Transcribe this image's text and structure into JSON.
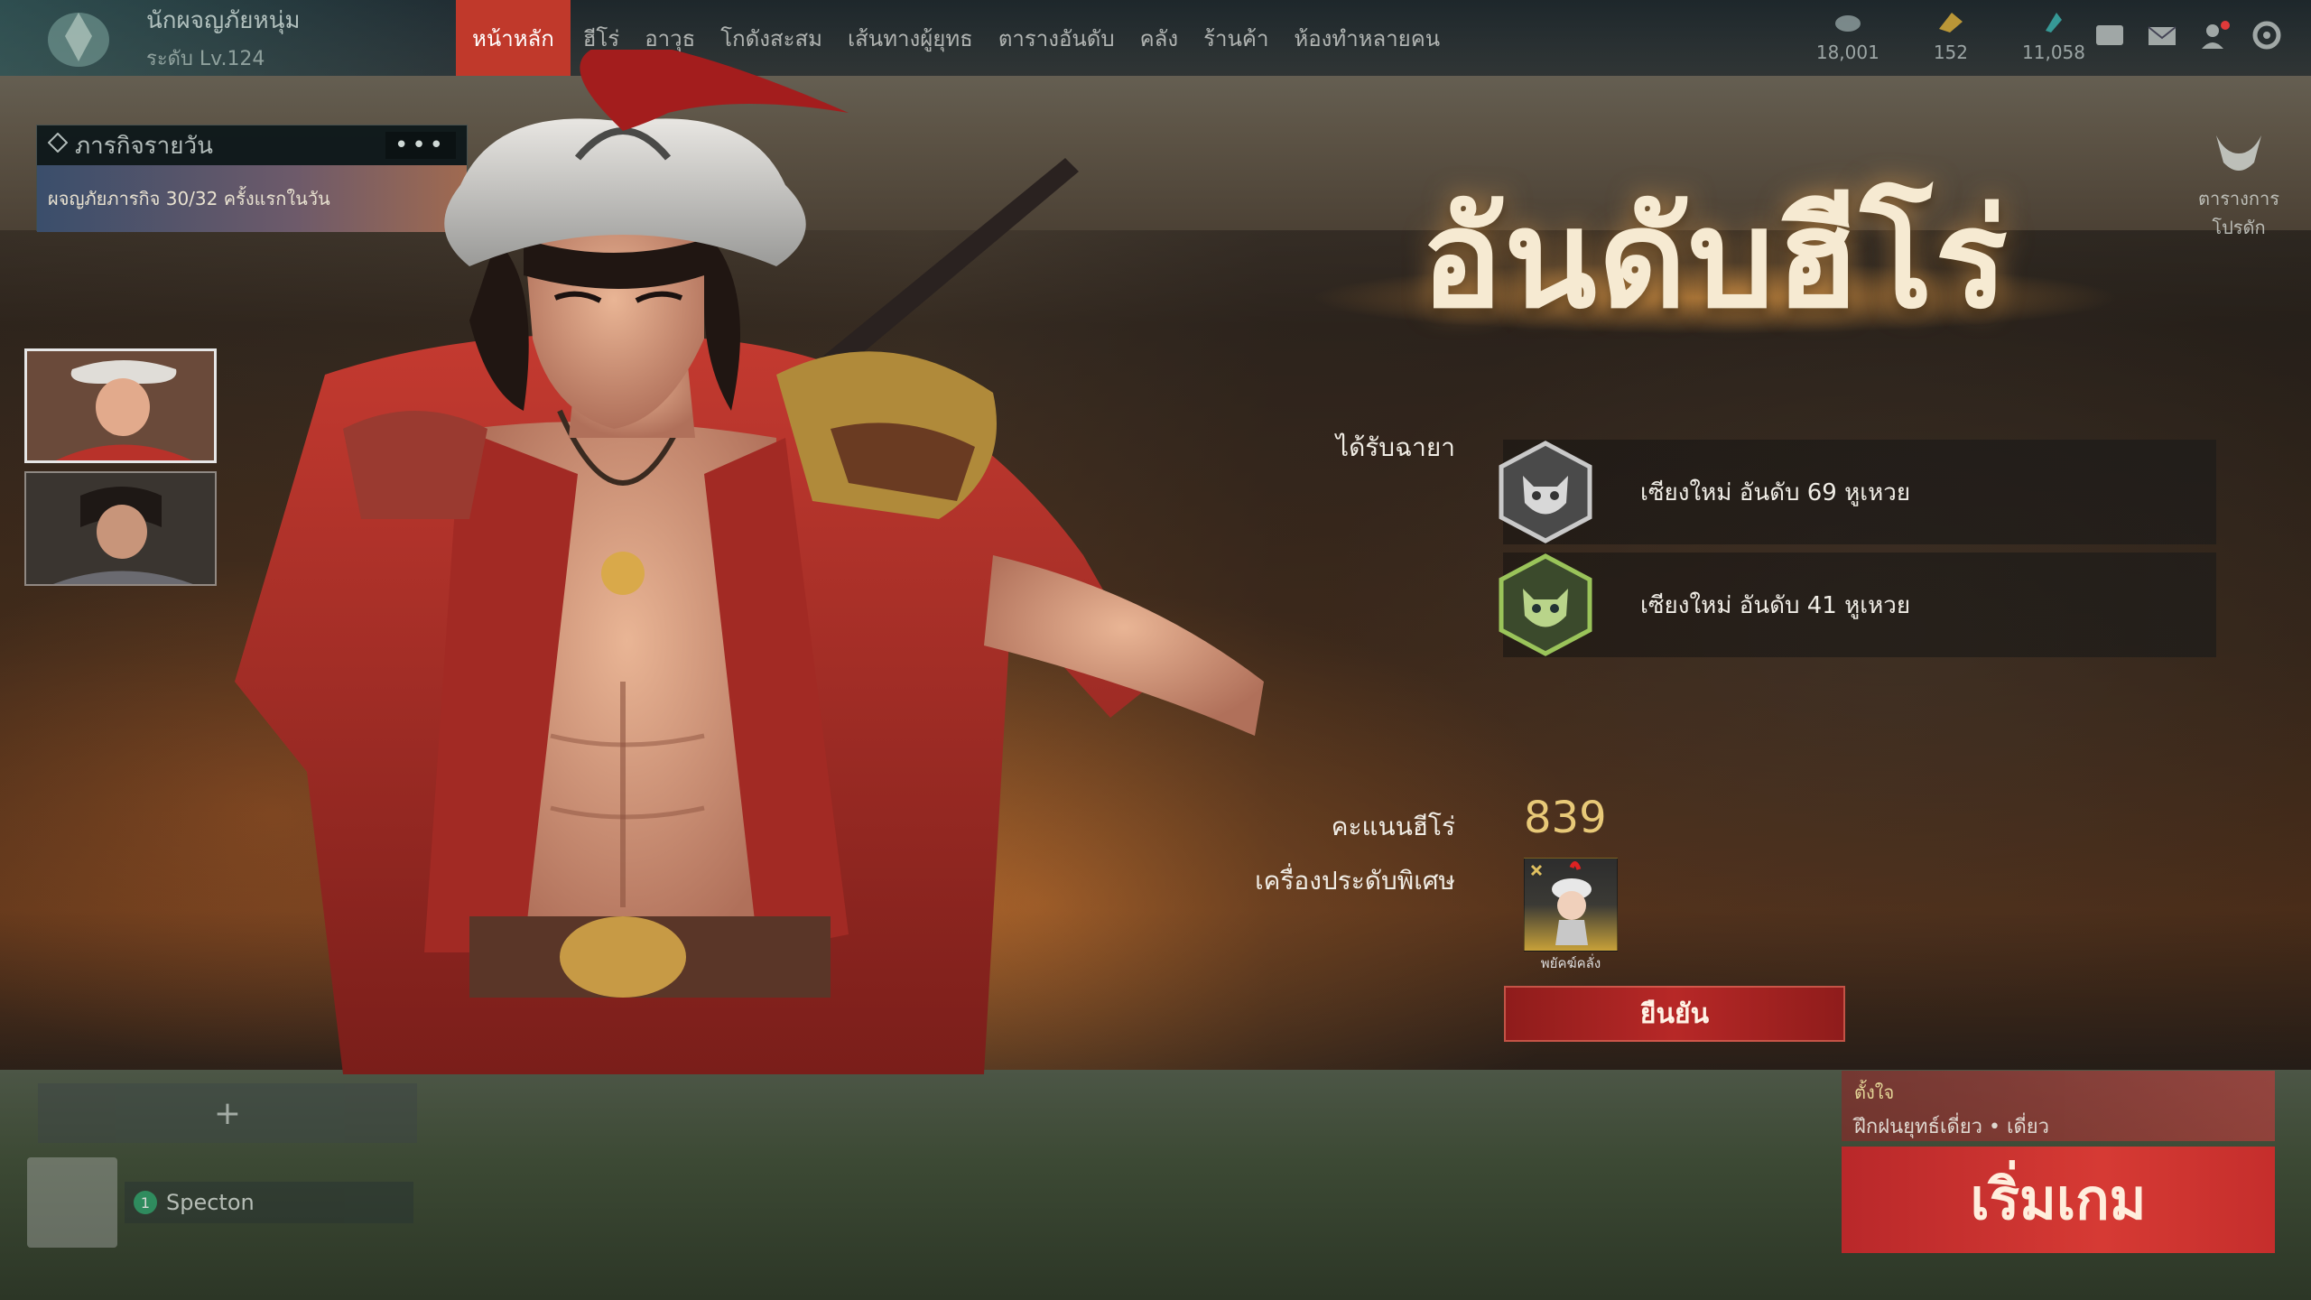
{
  "topbar": {
    "profile_name": "นักผจญภัยหนุ่ม",
    "profile_level": "ระดับ Lv.124",
    "nav": [
      "หน้าหลัก",
      "ฮีโร่",
      "อาวุธ",
      "โกดังสะสม",
      "เส้นทางผู้ยุทธ",
      "ตารางอันดับ",
      "คลัง",
      "ร้านค้า",
      "ห้องทำหลายคน"
    ],
    "resources": [
      {
        "icon": "coin-icon",
        "value": "18,001"
      },
      {
        "icon": "gold-icon",
        "value": "152"
      },
      {
        "icon": "jade-icon",
        "value": "11,058"
      }
    ]
  },
  "daily": {
    "title": "ภารกิจรายวัน",
    "more": "•••",
    "banner": "ผจญภัยภารกิจ 30/32 ครั้งแรกในวัน"
  },
  "title": "อันดับฮีโร่",
  "received_label": "ได้รับฉายา",
  "titles": [
    {
      "text": "เซียงใหม่ อันดับ 69 หูเหวย",
      "icon": "silver-demon-badge-icon"
    },
    {
      "text": "เซียงใหม่ อันดับ 41 หูเหวย",
      "icon": "green-demon-badge-icon"
    }
  ],
  "score_label": "คะแนนฮีโร่",
  "score_value": "839",
  "accessory_label": "เครื่องประดับพิเศษ",
  "accessory_name": "พยัคฆ์คลั่ง",
  "confirm_label": "ยืนยัน",
  "side_shortcut": "ตารางการโปรดัก",
  "lobby": {
    "add_label": "+",
    "member_name": "Specton",
    "member_rank": "1",
    "mode_line1": "ตั้งใจ",
    "mode_line2": "ฝึกฝนยุทธ์เดี่ยว • เดี่ยว",
    "start_label": "เริ่มเกม"
  },
  "colors": {
    "accent": "#c0392b",
    "score": "#e8c978",
    "confirm": "#b72827"
  }
}
